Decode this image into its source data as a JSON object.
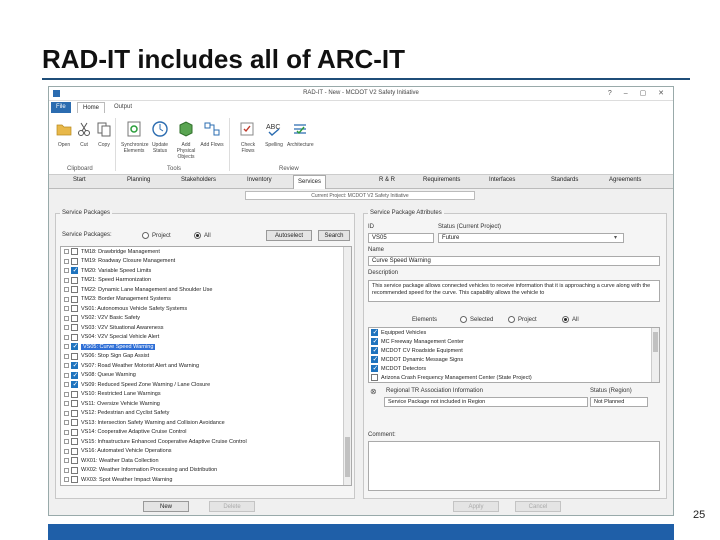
{
  "slide": {
    "title": "RAD-IT includes all of ARC-IT",
    "page_number": "25"
  },
  "app": {
    "window_title": "RAD-IT - New - MCDOT V2 Safety Initiative",
    "ribbon_tabs": [
      "File",
      "Home",
      "Output"
    ],
    "ribbon_buttons": [
      {
        "label": "Open",
        "icon": "folder-icon"
      },
      {
        "label": "Cut",
        "icon": "scissors-icon"
      },
      {
        "label": "Copy",
        "icon": "copy-icon"
      },
      {
        "label": "Synchronize Elements",
        "icon": "sync-icon"
      },
      {
        "label": "Update Status",
        "icon": "clock-icon"
      },
      {
        "label": "Add Physical Objects",
        "icon": "cube-icon"
      },
      {
        "label": "Add Flows",
        "icon": "flow-icon"
      },
      {
        "label": "Check Flows",
        "icon": "check-flows-icon"
      },
      {
        "label": "Spelling",
        "icon": "spelling-icon"
      },
      {
        "label": "Architecture",
        "icon": "architecture-icon"
      }
    ],
    "ribbon_groups": [
      "Clipboard",
      "Tools",
      "Review"
    ],
    "nav_tabs": [
      "Start",
      "Planning",
      "Stakeholders",
      "Inventory",
      "Services",
      "R & R",
      "Requirements",
      "Interfaces",
      "Standards",
      "Agreements"
    ],
    "current_project": "Current Project: MCDOT V2 Safety Initiative",
    "service_packages": {
      "panel_title": "Service Packages",
      "filter_label": "Service Packages:",
      "radio_project": "Project",
      "radio_all": "All",
      "autoselect_label": "Autoselect",
      "search_label": "Search",
      "items": [
        {
          "text": "TM18: Drawbridge Management",
          "checked": false,
          "selected": false
        },
        {
          "text": "TM19: Roadway Closure Management",
          "checked": false,
          "selected": false
        },
        {
          "text": "TM20: Variable Speed Limits",
          "checked": true,
          "selected": false
        },
        {
          "text": "TM21: Speed Harmonization",
          "checked": false,
          "selected": false
        },
        {
          "text": "TM22: Dynamic Lane Management and Shoulder Use",
          "checked": false,
          "selected": false
        },
        {
          "text": "TM23: Border Management Systems",
          "checked": false,
          "selected": false
        },
        {
          "text": "VS01: Autonomous Vehicle Safety Systems",
          "checked": false,
          "selected": false
        },
        {
          "text": "VS02: V2V Basic Safety",
          "checked": false,
          "selected": false
        },
        {
          "text": "VS03: V2V Situational Awareness",
          "checked": false,
          "selected": false
        },
        {
          "text": "VS04: V2V Special Vehicle Alert",
          "checked": false,
          "selected": false
        },
        {
          "text": "VS05: Curve Speed Warning",
          "checked": true,
          "selected": true
        },
        {
          "text": "VS06: Stop Sign Gap Assist",
          "checked": false,
          "selected": false
        },
        {
          "text": "VS07: Road Weather Motorist Alert and Warning",
          "checked": true,
          "selected": false
        },
        {
          "text": "VS08: Queue Warning",
          "checked": true,
          "selected": false
        },
        {
          "text": "VS09: Reduced Speed Zone Warning / Lane Closure",
          "checked": true,
          "selected": false
        },
        {
          "text": "VS10: Restricted Lane Warnings",
          "checked": false,
          "selected": false
        },
        {
          "text": "VS11: Oversize Vehicle Warning",
          "checked": false,
          "selected": false
        },
        {
          "text": "VS12: Pedestrian and Cyclist Safety",
          "checked": false,
          "selected": false
        },
        {
          "text": "VS13: Intersection Safety Warning and Collision Avoidance",
          "checked": false,
          "selected": false
        },
        {
          "text": "VS14: Cooperative Adaptive Cruise Control",
          "checked": false,
          "selected": false
        },
        {
          "text": "VS15: Infrastructure Enhanced Cooperative Adaptive Cruise Control",
          "checked": false,
          "selected": false
        },
        {
          "text": "VS16: Automated Vehicle Operations",
          "checked": false,
          "selected": false
        },
        {
          "text": "WX01: Weather Data Collection",
          "checked": false,
          "selected": false
        },
        {
          "text": "WX02: Weather Information Processing and Distribution",
          "checked": false,
          "selected": false
        },
        {
          "text": "WX03: Spot Weather Impact Warning",
          "checked": false,
          "selected": false
        }
      ],
      "new_label": "New",
      "delete_label": "Delete"
    },
    "attributes": {
      "panel_title": "Service Package Attributes",
      "id_label": "ID",
      "id_value": "VS05",
      "status_label": "Status (Current Project)",
      "status_value": "Future",
      "name_label": "Name",
      "name_value": "Curve Speed Warning",
      "description_label": "Description",
      "description_value": "This service package allows connected vehicles to receive information that it is approaching a curve along with the recommended speed for the curve. This capability allows the vehicle to",
      "elements_label": "Elements",
      "radio_selected": "Selected",
      "radio_project": "Project",
      "radio_all": "All",
      "elements": [
        {
          "text": "Equipped Vehicles",
          "checked": true
        },
        {
          "text": "MC Freeway Management Center",
          "checked": true
        },
        {
          "text": "MCDOT CV Roadside Equipment",
          "checked": true
        },
        {
          "text": "MCDOT Dynamic Message Signs",
          "checked": true
        },
        {
          "text": "MCDOT Detectors",
          "checked": true
        },
        {
          "text": "Arizona Crash Frequency Management Center (State Project)",
          "checked": false
        }
      ],
      "regional_header": "Regional TR Association Information",
      "status_region_header": "Status (Region)",
      "regional_value": "Service Package not included in Region",
      "status_region_value": "Not Planned",
      "comment_label": "Comment:",
      "apply_label": "Apply",
      "cancel_label": "Cancel"
    }
  }
}
